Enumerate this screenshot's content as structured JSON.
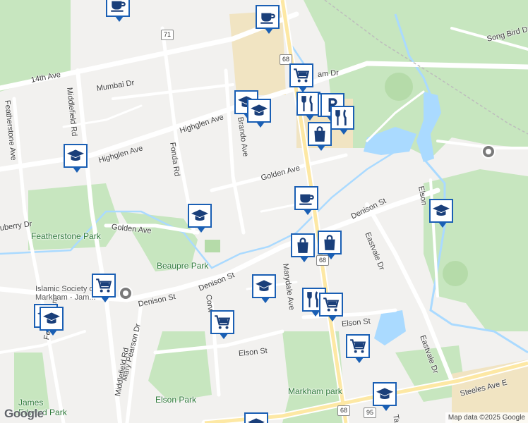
{
  "map": {
    "colors": {
      "background": "#f2f1ef",
      "park": "#c7e6bf",
      "water": "#aadaff",
      "road": "#ffffff",
      "highway": "#fde8a4",
      "pin": "#1a5fb4",
      "commercial": "#f1e4c2"
    },
    "streets": {
      "fourteenth": "14th Ave",
      "mumbai": "Mumbai Dr",
      "middlefield_n": "Middlefield Rd",
      "middlefield_s": "Middlefield Rd",
      "featherstone_ave": "Featherstone Ave",
      "featherstone_s": "Featherstone",
      "highglen_w": "Highglen Ave",
      "highglen_e": "Highglen Ave",
      "fonda": "Fonda Rd",
      "brando": "Brando Ave",
      "golden_e": "Golden Ave",
      "golden_w": "Golden Ave",
      "berry": "uberry Dr",
      "denison_w": "Denison St",
      "denison_mid": "Denison St",
      "denison_e": "Denison St",
      "marydale": "Marydale Ave",
      "eastvale_n": "Eastvale Dr",
      "eastvale_s": "Eastvale Dr",
      "elson_e": "Elson St",
      "elson_w": "Elson St",
      "elson_n": "Elson",
      "steeles": "Steeles Ave E",
      "mary_pearson": "Mary Pearson Dr",
      "corw": "Corw",
      "song_bird": "Song Bird Dr",
      "tap": "Ta",
      "mam": "am Dr"
    },
    "parks": {
      "featherstone": "Featherstone Park",
      "beaupre": "Beaupre Park",
      "elson": "Elson Park",
      "markham": "Markham park",
      "james": "James Edward Park"
    },
    "places": {
      "islamic": "Islamic Society of Markham - Jam..."
    },
    "shields": [
      "71",
      "68",
      "68",
      "68",
      "95"
    ],
    "attribution": "Map data ©2025 Google",
    "logo": "Google",
    "pins": [
      {
        "icon": "coffee"
      },
      {
        "icon": "coffee"
      },
      {
        "icon": "cart"
      },
      {
        "icon": "school"
      },
      {
        "icon": "school"
      },
      {
        "icon": "restaurant"
      },
      {
        "icon": "restaurant"
      },
      {
        "icon": "parking"
      },
      {
        "icon": "restaurant"
      },
      {
        "icon": "shopping"
      },
      {
        "icon": "school"
      },
      {
        "icon": "school"
      },
      {
        "icon": "coffee"
      },
      {
        "icon": "school"
      },
      {
        "icon": "shopping"
      },
      {
        "icon": "shopping"
      },
      {
        "icon": "cart"
      },
      {
        "icon": "school"
      },
      {
        "icon": "restaurant"
      },
      {
        "icon": "cart"
      },
      {
        "icon": "school"
      },
      {
        "icon": "school"
      },
      {
        "icon": "cart"
      },
      {
        "icon": "cart"
      },
      {
        "icon": "school"
      },
      {
        "icon": "school"
      }
    ]
  }
}
